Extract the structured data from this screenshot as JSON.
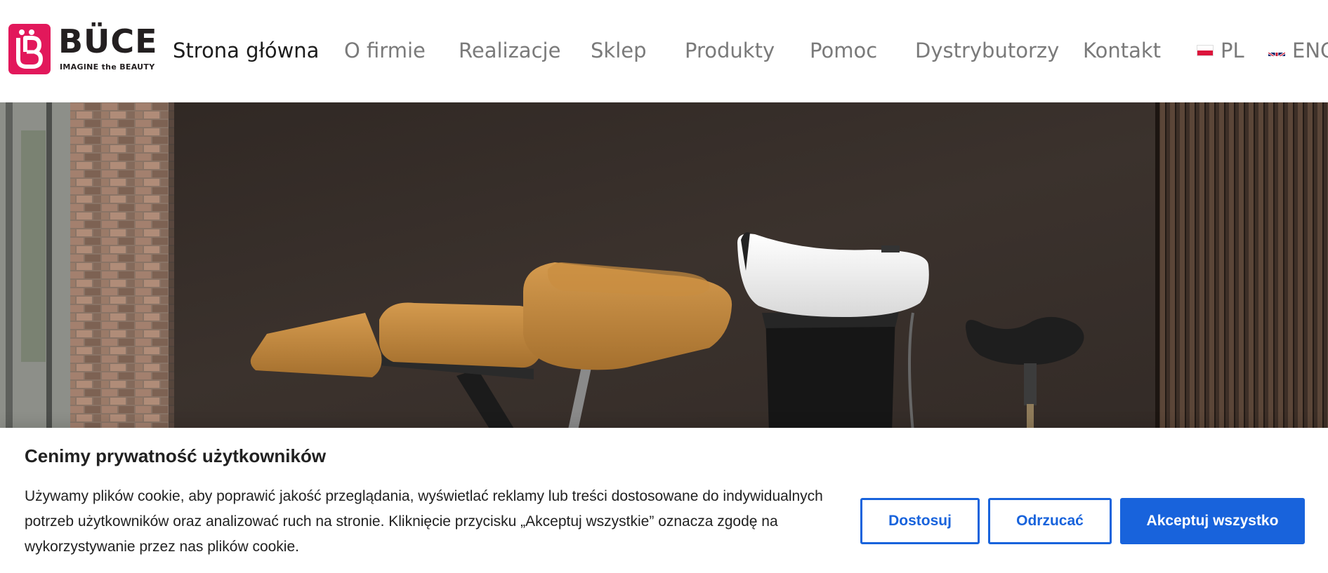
{
  "brand": {
    "name": "BÜCE",
    "tagline": "IMAGINE the BEAUTY",
    "accent_color": "#e2185b"
  },
  "nav": {
    "items": [
      {
        "label": "Strona główna",
        "active": true
      },
      {
        "label": "O firmie"
      },
      {
        "label": "Realizacje"
      },
      {
        "label": "Sklep"
      },
      {
        "label": "Produkty"
      },
      {
        "label": "Pomoc"
      },
      {
        "label": "Dystrybutorzy"
      },
      {
        "label": "Kontakt"
      }
    ],
    "languages": [
      {
        "label": "PL",
        "flag": "poland-flag-icon"
      },
      {
        "label": "ENG",
        "flag": "uk-flag-icon"
      }
    ]
  },
  "hero": {
    "image": "salon-wash-unit-with-reclined-chair-and-stool"
  },
  "cookie_banner": {
    "title": "Cenimy prywatność użytkowników",
    "text": "Używamy plików cookie, aby poprawić jakość przeglądania, wyświetlać reklamy lub treści dostosowane do indywidualnych potrzeb użytkowników oraz analizować ruch na stronie. Kliknięcie przycisku „Akceptuj wszystkie” oznacza zgodę na wykorzystywanie przez nas plików cookie.",
    "buttons": {
      "customize": "Dostosuj",
      "reject": "Odrzucać",
      "accept_all": "Akceptuj wszystko"
    },
    "button_color": "#1863dc"
  }
}
